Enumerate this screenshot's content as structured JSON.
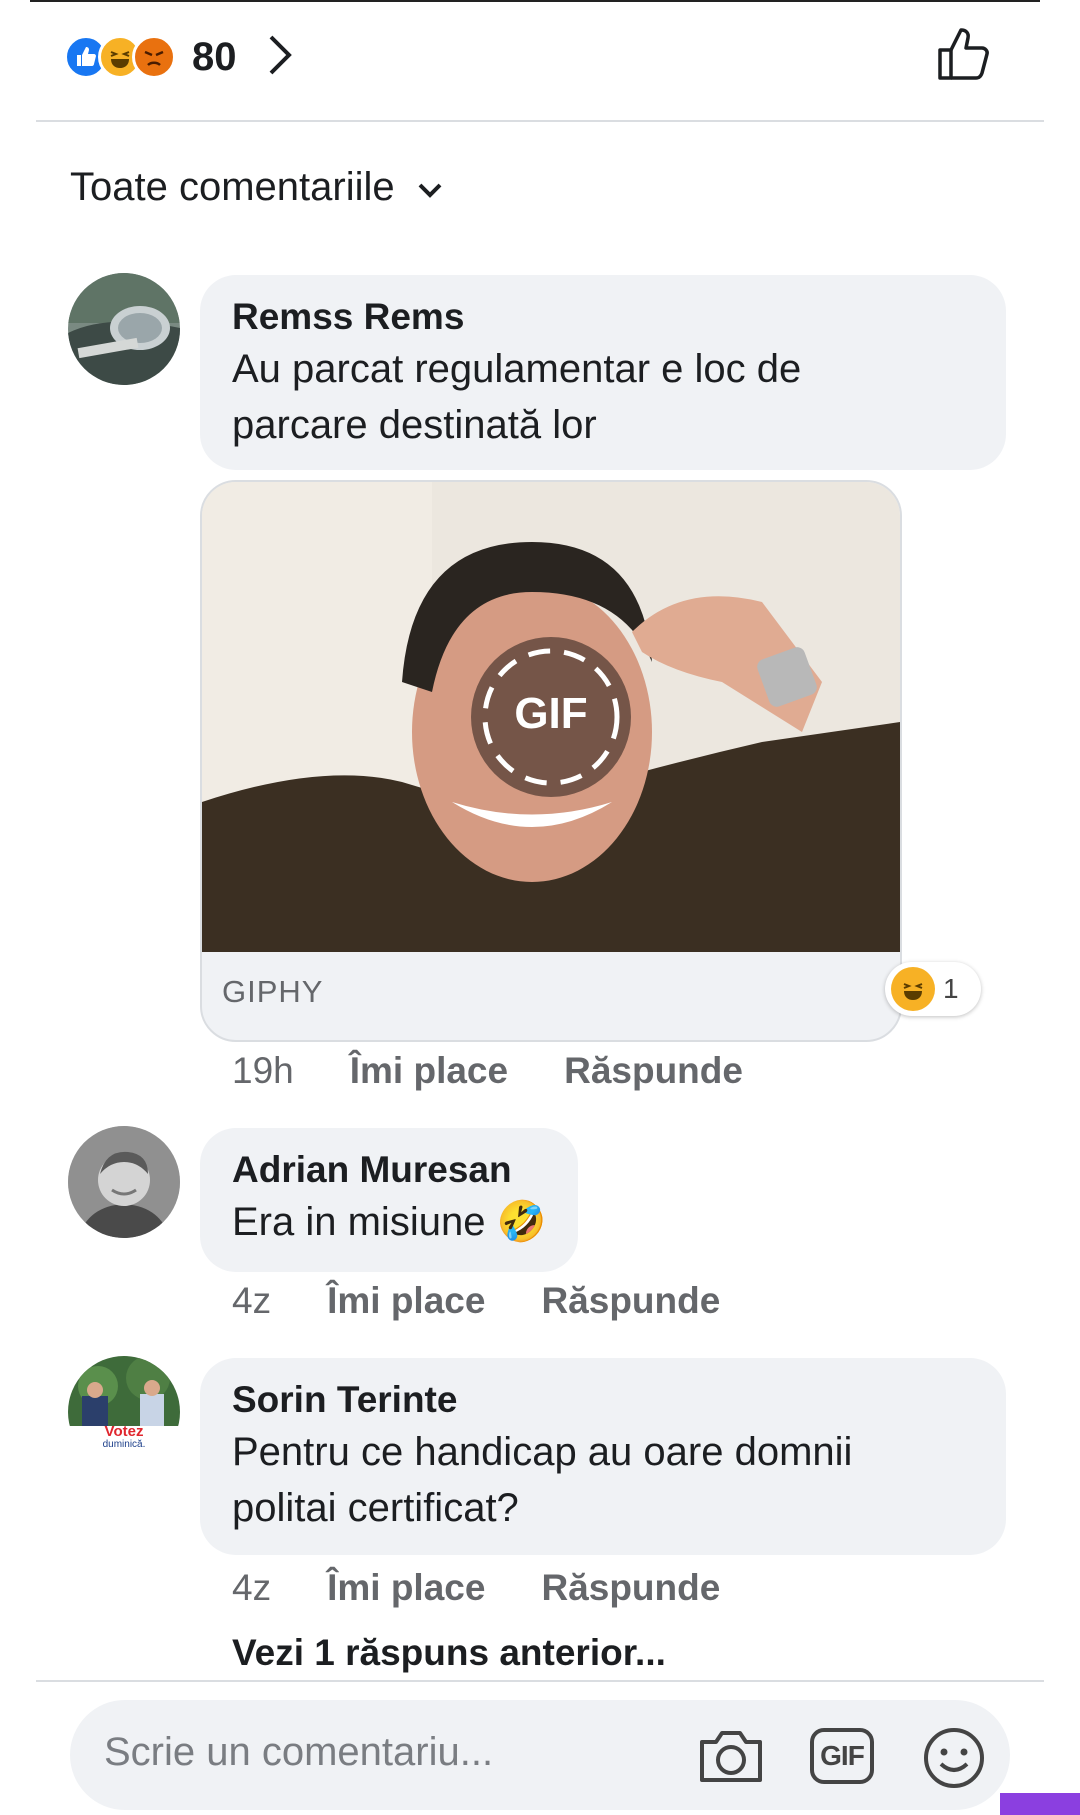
{
  "reactions": {
    "icons": [
      "like-icon",
      "haha-icon",
      "angry-icon"
    ],
    "count": "80"
  },
  "sort": {
    "label": "Toate comentariile"
  },
  "comments": [
    {
      "author": "Remss Rems",
      "text_lines": [
        "Au parcat regulamentar e loc de",
        "parcare destinată lor"
      ],
      "attachment": {
        "badge": "GIF",
        "source": "GIPHY",
        "reaction_icon": "haha-icon",
        "reaction_count": "1"
      },
      "time": "19h",
      "like": "Îmi place",
      "reply": "Răspunde"
    },
    {
      "author": "Adrian Muresan",
      "text": "Era in misiune",
      "emoji": "🤣",
      "time": "4z",
      "like": "Îmi place",
      "reply": "Răspunde"
    },
    {
      "author": "Sorin Terinte",
      "text_lines": [
        "Pentru ce handicap au oare domnii",
        "politai certificat?"
      ],
      "avatar_text": [
        "Votez",
        "duminică."
      ],
      "time": "4z",
      "like": "Îmi place",
      "reply": "Răspunde"
    }
  ],
  "see_more": "Vezi 1 răspuns anterior...",
  "composer": {
    "placeholder": "Scrie un comentariu...",
    "gif_label": "GIF",
    "icons": [
      "camera-icon",
      "gif-icon",
      "smiley-icon"
    ]
  },
  "colors": {
    "bubble": "#f0f2f5",
    "meta_text": "#65676b",
    "like_blue": "#1877f2",
    "haha_yellow": "#f7b125",
    "angry_orange": "#e9710f"
  }
}
